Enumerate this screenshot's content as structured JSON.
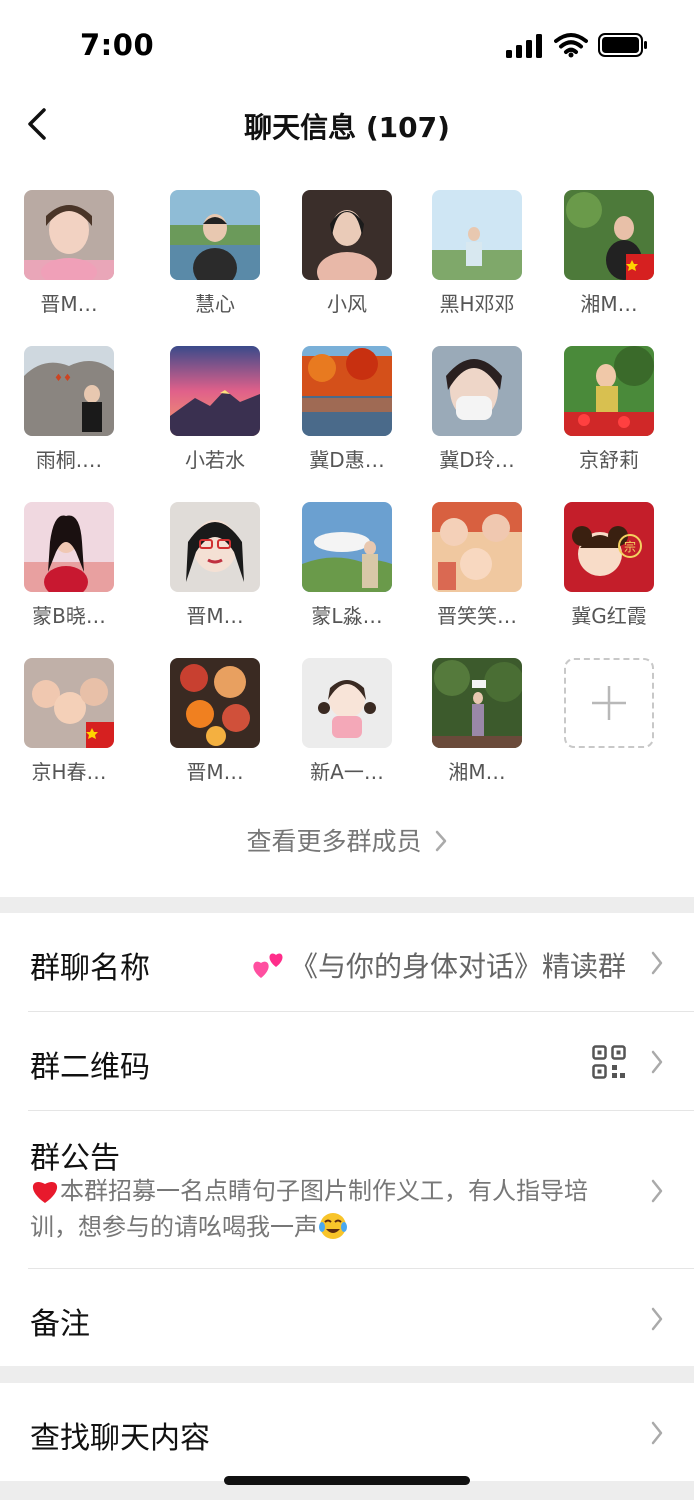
{
  "status_bar": {
    "time": "7:00"
  },
  "header": {
    "title": "聊天信息 (107)"
  },
  "members": [
    {
      "name": "晋M…",
      "avatar": "woman-portrait-pink",
      "flag": false
    },
    {
      "name": "慧心",
      "avatar": "woman-by-lake",
      "flag": false
    },
    {
      "name": "小风",
      "avatar": "person-in-car",
      "flag": false
    },
    {
      "name": "黑H邓邓",
      "avatar": "woman-outdoor-sky",
      "flag": false
    },
    {
      "name": "湘M…",
      "avatar": "woman-green-forest",
      "flag": true
    },
    {
      "name": "雨桐.…",
      "avatar": "woman-rock-carving",
      "flag": false
    },
    {
      "name": "小若水",
      "avatar": "snow-mountain-sunset",
      "flag": false
    },
    {
      "name": "冀D惠…",
      "avatar": "autumn-lake",
      "flag": false
    },
    {
      "name": "冀D玲…",
      "avatar": "woman-face-mask",
      "flag": false
    },
    {
      "name": "京舒莉",
      "avatar": "woman-red-flowers",
      "flag": false
    },
    {
      "name": "蒙B晓…",
      "avatar": "woman-red-background",
      "flag": false
    },
    {
      "name": "晋M…",
      "avatar": "woman-glasses-portrait",
      "flag": false
    },
    {
      "name": "蒙L淼…",
      "avatar": "woman-grassland",
      "flag": false
    },
    {
      "name": "晋笑笑…",
      "avatar": "family-collage",
      "flag": false
    },
    {
      "name": "冀G红霞",
      "avatar": "cartoon-girl-red",
      "flag": false
    },
    {
      "name": "京H春…",
      "avatar": "kids-photo",
      "flag": true
    },
    {
      "name": "晋M…",
      "avatar": "food-platter",
      "flag": false
    },
    {
      "name": "新A一…",
      "avatar": "cartoon-girl-pink",
      "flag": false
    },
    {
      "name": "湘M…",
      "avatar": "person-in-garden",
      "flag": false
    }
  ],
  "add_member": {
    "icon": "plus-icon"
  },
  "view_more": {
    "label": "查看更多群成员"
  },
  "settings": {
    "group_name": {
      "label": "群聊名称",
      "value": "《与你的身体对话》精读群",
      "icon": "two-hearts-emoji"
    },
    "qr_code": {
      "label": "群二维码",
      "icon": "qr-code-icon"
    },
    "notice": {
      "label": "群公告",
      "text_part1": "本群招募一名点睛句子图片制作义工，有人指导培训，想参与的请吆喝我一声",
      "leading_icon": "red-heart-emoji",
      "trailing_icon": "tears-of-joy-emoji"
    },
    "remark": {
      "label": "备注"
    },
    "search_chat": {
      "label": "查找聊天内容"
    }
  },
  "colors": {
    "background": "#ededed",
    "surface": "#ffffff",
    "text_primary": "#111111",
    "text_secondary": "#777777",
    "divider": "#e5e5e5"
  }
}
